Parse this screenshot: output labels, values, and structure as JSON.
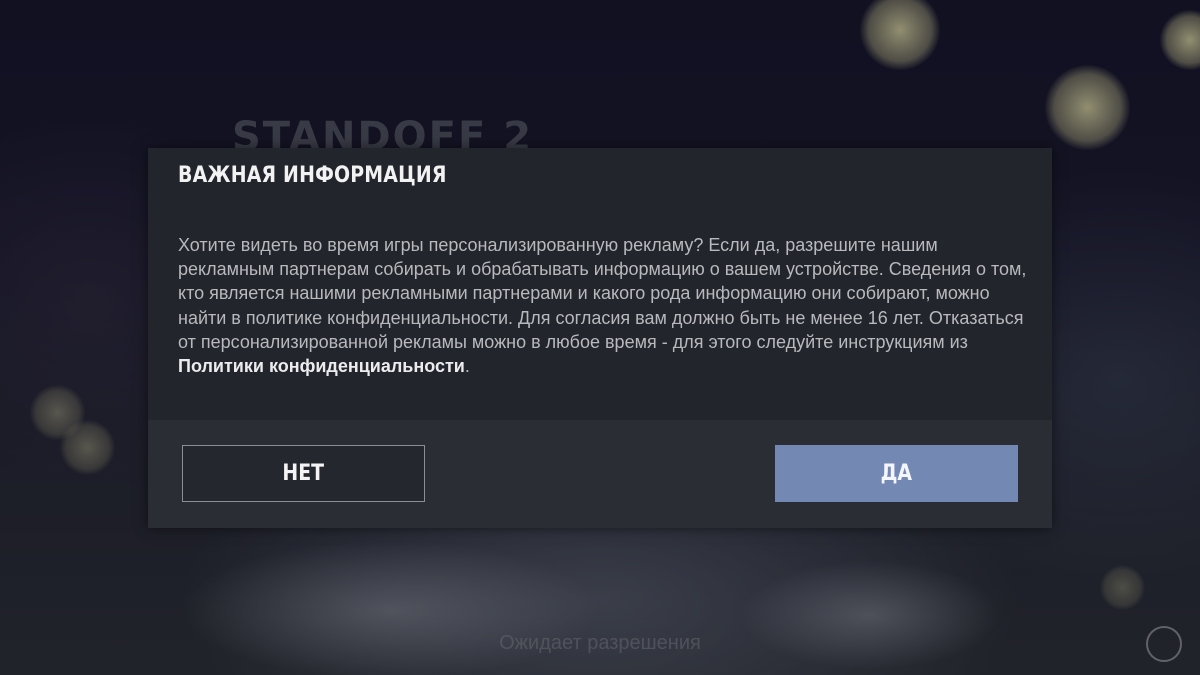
{
  "background": {
    "logo_text": "STANDOFF 2",
    "status_text": "Ожидает разрешения"
  },
  "dialog": {
    "title": "ВАЖНАЯ ИНФОРМАЦИЯ",
    "body_text": "Хотите видеть во время игры персонализированную рекламу? Если да, разрешите нашим рекламным партнерам собирать и обрабатывать информацию о вашем устройстве. Сведения о том, кто является нашими рекламными партнерами и какого рода информацию они собирают, можно найти в политике конфиденциальности. Для согласия вам должно быть не менее 16 лет. Отказаться от персонализированной рекламы можно в любое время - для этого следуйте инструкциям из ",
    "privacy_link": "Политики конфиденциальности",
    "body_end": ".",
    "no_label": "НЕТ",
    "yes_label": "ДА"
  },
  "colors": {
    "dialog_bg": "#23252c",
    "footer_bg": "#2b2d34",
    "accent_button": "#7389b4"
  }
}
